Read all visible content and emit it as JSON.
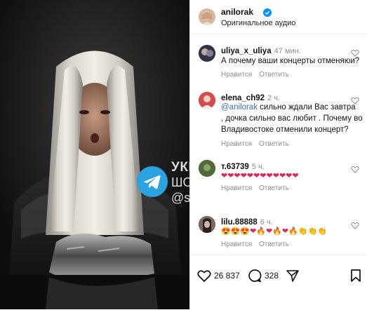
{
  "post": {
    "username": "anilorak",
    "audio_label": "Оригинальное аудио",
    "watermark": {
      "line1": "УКРАЇНСЬКИЙ",
      "line2": "ШОУ-БІЗНЕС",
      "line3": "@showbiz"
    }
  },
  "comments": [
    {
      "user": "uliya_x_uliya",
      "time": "47 мин.",
      "text": "А почему ваши концерты отменяюи?",
      "like_label": "Нравится",
      "reply_label": "Ответить"
    },
    {
      "user": "elena_ch92",
      "time": "2 ч.",
      "mention": "@anilorak",
      "text_line1": " сильно ждали Вас завтра",
      "text_line2": ", дочка сильно вас любит . Почему во",
      "text_line3": "Владивостоке отменили концерт?",
      "like_label": "Нравится",
      "reply_label": "Ответить"
    },
    {
      "user": "т.63739",
      "time": "5 ч.",
      "text": "❤❤❤❤❤❤❤❤❤❤❤❤",
      "like_label": "Нравится",
      "reply_label": "Ответить"
    },
    {
      "user": "lilu.88888",
      "time": "6 ч.",
      "text": "😍😍😍❤🔥❤🔥❤🔥👏👏👏",
      "like_label": "Нравится",
      "reply_label": "Ответить"
    }
  ],
  "footer": {
    "likes_count": "26 837",
    "comments_count": "328"
  },
  "colors": {
    "accent_blue": "#3a6fb0",
    "verified_blue": "#0095f6",
    "telegram_blue": "#2aa3e0",
    "muted_gray": "#8e8e8e"
  },
  "icons": [
    "telegram-icon",
    "verified-icon",
    "heart-icon",
    "comment-icon",
    "share-icon",
    "bookmark-icon"
  ]
}
